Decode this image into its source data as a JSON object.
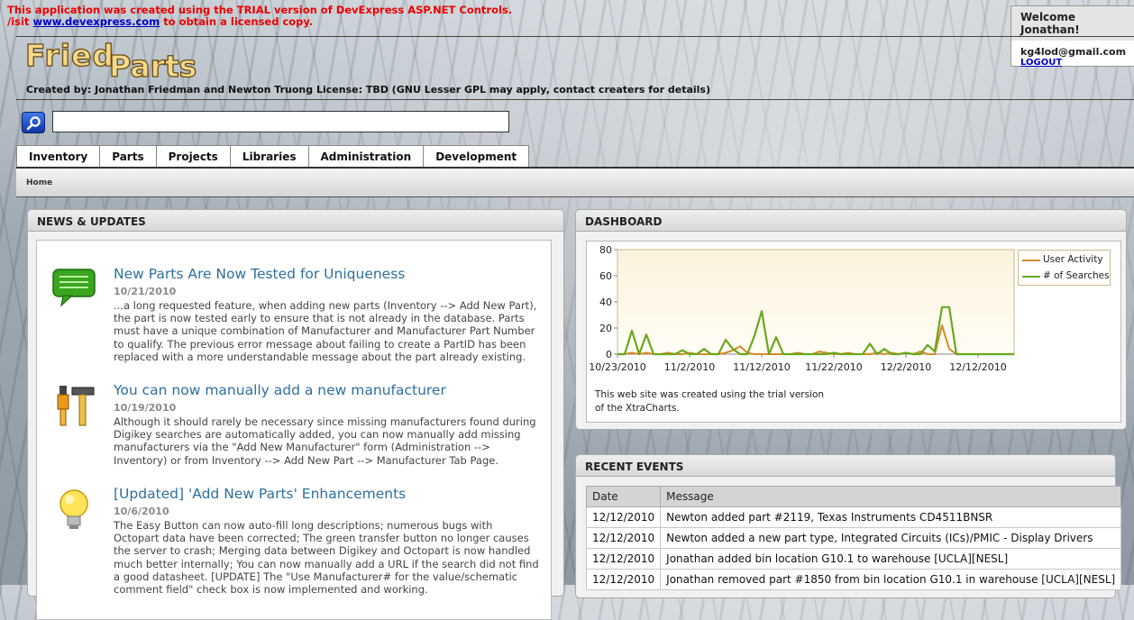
{
  "trial_notice": {
    "line1": "This application was created using the TRIAL version of DevExpress ASP.NET Controls.",
    "line2_prefix": "/isit",
    "line2_link": "www.devexpress.com",
    "line2_suffix": "to obtain a licensed copy."
  },
  "user_box": {
    "welcome": "Welcome Jonathan!",
    "email": "kg4lod@gmail.com",
    "logout": "LOGOUT"
  },
  "header": {
    "logo_word1": "Fried",
    "logo_word2": "Parts",
    "credits": "Created by: Jonathan Friedman and Newton Truong",
    "license": "License: TBD (GNU Lesser GPL may apply, contact creaters for details)"
  },
  "search": {
    "value": "",
    "icon": "search-icon"
  },
  "nav": {
    "tabs": [
      "Inventory",
      "Parts",
      "Projects",
      "Libraries",
      "Administration",
      "Development"
    ]
  },
  "breadcrumb": {
    "home": "Home"
  },
  "news": {
    "heading": "NEWS & UPDATES",
    "items": [
      {
        "icon": "chat-bubble-icon",
        "title": "New Parts Are Now Tested for Uniqueness",
        "date": "10/21/2010",
        "body": "...a long requested feature, when adding new parts (Inventory --> Add New Part), the part is now tested early to ensure that is not already in the database. Parts must have a unique combination of Manufacturer and Manufacturer Part Number to qualify. The previous error message about failing to create a PartID has been replaced with a more understandable message about the part already existing."
      },
      {
        "icon": "tools-icon",
        "title": "You can now manually add a new manufacturer",
        "date": "10/19/2010",
        "body": "Although it should rarely be necessary since missing manufacturers found during Digikey searches are automatically added, you can now manually add missing manufacturers via the \"Add New Manufacturer\" form (Administration --> Inventory) or from Inventory --> Add New Part --> Manufacturer Tab Page."
      },
      {
        "icon": "lightbulb-icon",
        "title": "[Updated] 'Add New Parts' Enhancements",
        "date": "10/6/2010",
        "body": "The Easy Button can now auto-fill long descriptions; numerous bugs with Octopart data have been corrected; The green transfer button no longer causes the server to crash; Merging data between Digikey and Octopart is now handled much better internally; You can now manually add a URL if the search did not find a good datasheet. [UPDATE] The \"Use Manufacturer# for the value/schematic comment field\" check box is now implemented and working."
      }
    ]
  },
  "dashboard": {
    "heading": "DASHBOARD",
    "note_line1": "This web site was created using the trial version",
    "note_line2": "of the XtraCharts."
  },
  "chart_data": {
    "type": "line",
    "title": "",
    "xlabel": "",
    "ylabel": "",
    "x_start": "10/23/2010",
    "x_step_days": 1,
    "x_tick_labels": [
      "10/23/2010",
      "11/2/2010",
      "11/12/2010",
      "11/22/2010",
      "12/2/2010",
      "12/12/2010"
    ],
    "y_ticks": [
      0,
      20,
      40,
      60,
      80
    ],
    "ylim": [
      0,
      80
    ],
    "legend_position": "top-right",
    "series": [
      {
        "name": "User Activity",
        "color": "#d88a2a",
        "values": [
          0,
          0,
          1,
          0,
          1,
          0,
          0,
          1,
          0,
          0,
          1,
          0,
          0,
          0,
          0,
          1,
          3,
          6,
          1,
          0,
          0,
          0,
          0,
          0,
          0,
          1,
          0,
          0,
          2,
          1,
          0,
          0,
          1,
          0,
          0,
          0,
          1,
          0,
          1,
          0,
          1,
          0,
          2,
          0,
          0,
          22,
          4,
          0,
          0,
          0,
          0,
          0,
          0,
          0,
          0,
          0
        ]
      },
      {
        "name": "# of Searches",
        "color": "#69a81c",
        "values": [
          0,
          0,
          18,
          0,
          15,
          0,
          0,
          0,
          0,
          3,
          0,
          0,
          4,
          0,
          0,
          11,
          4,
          0,
          0,
          14,
          33,
          0,
          13,
          0,
          0,
          0,
          0,
          0,
          0,
          0,
          1,
          0,
          0,
          0,
          0,
          8,
          0,
          4,
          0,
          0,
          1,
          0,
          0,
          7,
          2,
          36,
          36,
          0,
          0,
          0,
          0,
          0,
          0,
          0,
          0,
          0
        ]
      }
    ]
  },
  "events": {
    "heading": "RECENT EVENTS",
    "columns": [
      "Date",
      "Message"
    ],
    "rows": [
      [
        "12/12/2010",
        "Newton added part #2119, Texas Instruments CD4511BNSR"
      ],
      [
        "12/12/2010",
        "Newton added a new part type, Integrated Circuits (ICs)/PMIC - Display Drivers"
      ],
      [
        "12/12/2010",
        "Jonathan added bin location G10.1 to warehouse [UCLA][NESL]"
      ],
      [
        "12/12/2010",
        "Jonathan removed part #1850 from bin location G10.1 in warehouse [UCLA][NESL]"
      ]
    ]
  }
}
